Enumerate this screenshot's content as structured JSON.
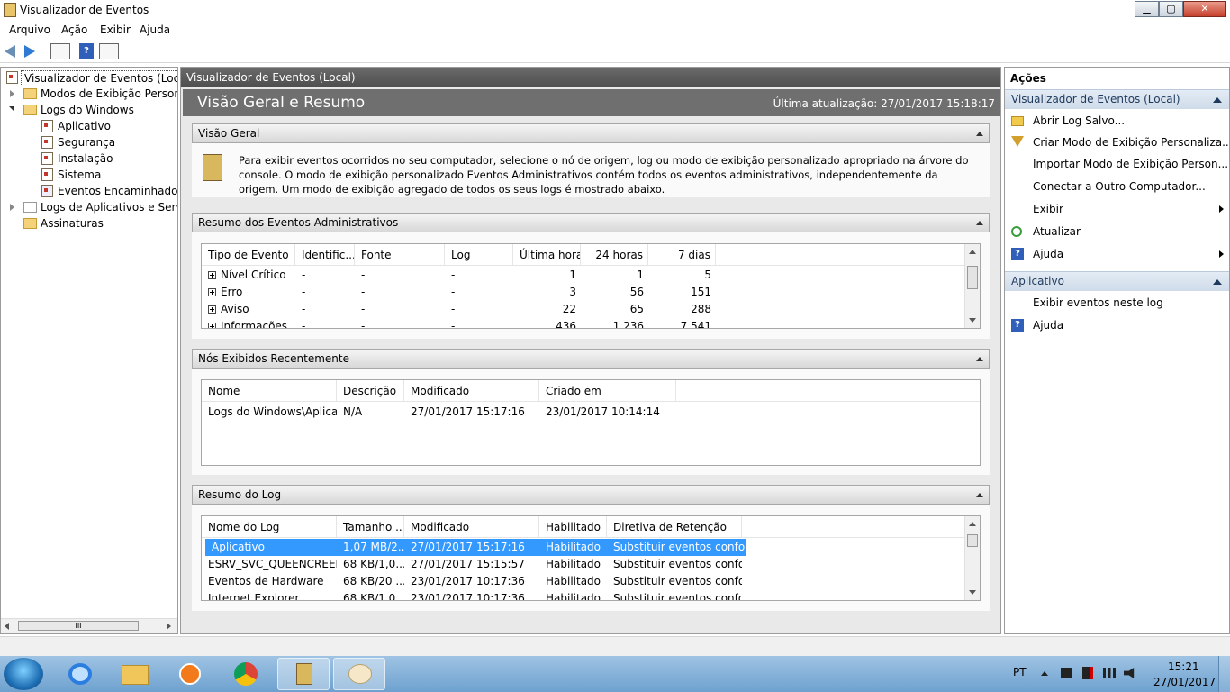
{
  "window": {
    "title": "Visualizador de Eventos",
    "min": "▁",
    "max": "▢",
    "close": "✕"
  },
  "menu": [
    "Arquivo",
    "Ação",
    "Exibir",
    "Ajuda"
  ],
  "toolbar": {
    "help": "?"
  },
  "tree": {
    "root": "Visualizador de Eventos (Local)",
    "custom_views": "Modos de Exibição Personalizados",
    "windows_logs": "Logs do Windows",
    "logs": [
      "Aplicativo",
      "Segurança",
      "Instalação",
      "Sistema",
      "Eventos Encaminhados"
    ],
    "app_logs": "Logs de Aplicativos e Serviços",
    "subscriptions": "Assinaturas",
    "scroll_grip": "III"
  },
  "center": {
    "header": "Visualizador de Eventos (Local)",
    "band_title": "Visão Geral e Resumo",
    "last_update": "Última atualização: 27/01/2017 15:18:17",
    "overview": {
      "title": "Visão Geral",
      "text": "Para exibir eventos ocorridos no seu computador, selecione o nó de origem, log ou modo de exibição personalizado apropriado na árvore do console. O modo de exibição personalizado Eventos Administrativos contém todos os eventos administrativos, independentemente da origem. Um modo de exibição agregado de todos os seus logs é mostrado abaixo."
    },
    "admin_summary": {
      "title": "Resumo dos Eventos Administrativos",
      "columns": [
        "Tipo de Evento",
        "Identific...",
        "Fonte",
        "Log",
        "Última hora",
        "24 horas",
        "7 dias"
      ],
      "rows": [
        [
          "Nível Crítico",
          "-",
          "-",
          "-",
          "1",
          "1",
          "5"
        ],
        [
          "Erro",
          "-",
          "-",
          "-",
          "3",
          "56",
          "151"
        ],
        [
          "Aviso",
          "-",
          "-",
          "-",
          "22",
          "65",
          "288"
        ],
        [
          "Informações",
          "-",
          "-",
          "-",
          "436",
          "1.236",
          "7.541"
        ]
      ]
    },
    "recent": {
      "title": "Nós Exibidos Recentemente",
      "columns": [
        "Nome",
        "Descrição",
        "Modificado",
        "Criado em"
      ],
      "rows": [
        [
          "Logs do Windows\\Aplica...",
          "N/A",
          "27/01/2017 15:17:16",
          "23/01/2017 10:14:14"
        ]
      ]
    },
    "log_summary": {
      "title": "Resumo do Log",
      "columns": [
        "Nome do Log",
        "Tamanho ...",
        "Modificado",
        "Habilitado",
        "Diretiva de Retenção"
      ],
      "rows": [
        [
          "Aplicativo",
          "1,07 MB/2...",
          "27/01/2017 15:17:16",
          "Habilitado",
          "Substituir eventos confo..."
        ],
        [
          "ESRV_SVC_QUEENCREEK",
          "68 KB/1,0...",
          "27/01/2017 15:15:57",
          "Habilitado",
          "Substituir eventos confo..."
        ],
        [
          "Eventos de Hardware",
          "68 KB/20 ...",
          "23/01/2017 10:17:36",
          "Habilitado",
          "Substituir eventos confo..."
        ],
        [
          "Internet Explorer",
          "68 KB/1,0...",
          "23/01/2017 10:17:36",
          "Habilitado",
          "Substituir eventos confo..."
        ]
      ]
    }
  },
  "actions": {
    "title": "Ações",
    "group1": "Visualizador de Eventos (Local)",
    "items1": [
      "Abrir Log Salvo...",
      "Criar Modo de Exibição Personaliza...",
      "Importar Modo de Exibição Person...",
      "Conectar a Outro Computador...",
      "Exibir",
      "Atualizar",
      "Ajuda"
    ],
    "group2": "Aplicativo",
    "items2": [
      "Exibir eventos neste log",
      "Ajuda"
    ],
    "help_glyph": "?"
  },
  "taskbar": {
    "lang": "PT",
    "time": "15:21",
    "date": "27/01/2017"
  },
  "colors": {
    "accent": "#3399ff",
    "header_dark": "#4e4e4e",
    "taskbar": "#6ea1cf"
  }
}
